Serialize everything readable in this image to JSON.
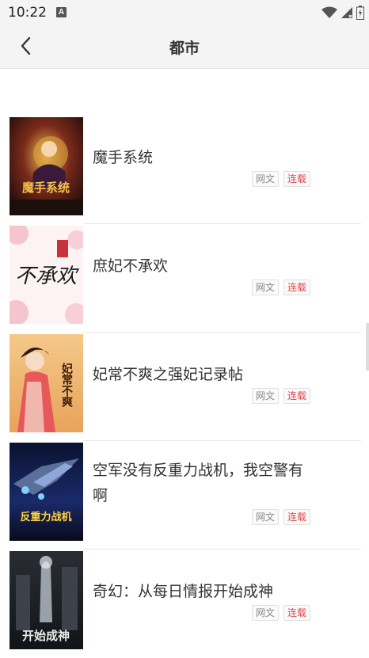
{
  "status_bar": {
    "time": "10:22",
    "notif_letter": "A"
  },
  "header": {
    "title": "都市"
  },
  "books": [
    {
      "title": "魔手系统",
      "genre_tag": "网文",
      "status_tag": "连载",
      "cover_text": "魔手系统"
    },
    {
      "title": "庶妃不承欢",
      "genre_tag": "网文",
      "status_tag": "连载",
      "cover_text": "不承欢"
    },
    {
      "title": "妃常不爽之强妃记录帖",
      "genre_tag": "网文",
      "status_tag": "连载",
      "cover_text": "妃常不爽"
    },
    {
      "title": "空军没有反重力战机，我空警有啊",
      "genre_tag": "网文",
      "status_tag": "连载",
      "cover_text": "反重力战机"
    },
    {
      "title": "奇幻：从每日情报开始成神",
      "genre_tag": "网文",
      "status_tag": "连载",
      "cover_text": "开始成神"
    }
  ],
  "colors": {
    "accent_red": "#e0474c",
    "header_bg": "#f4f4f4"
  },
  "icons": {
    "back": "chevron-left-icon",
    "wifi": "wifi-icon",
    "signal": "signal-icon",
    "battery": "battery-icon"
  }
}
